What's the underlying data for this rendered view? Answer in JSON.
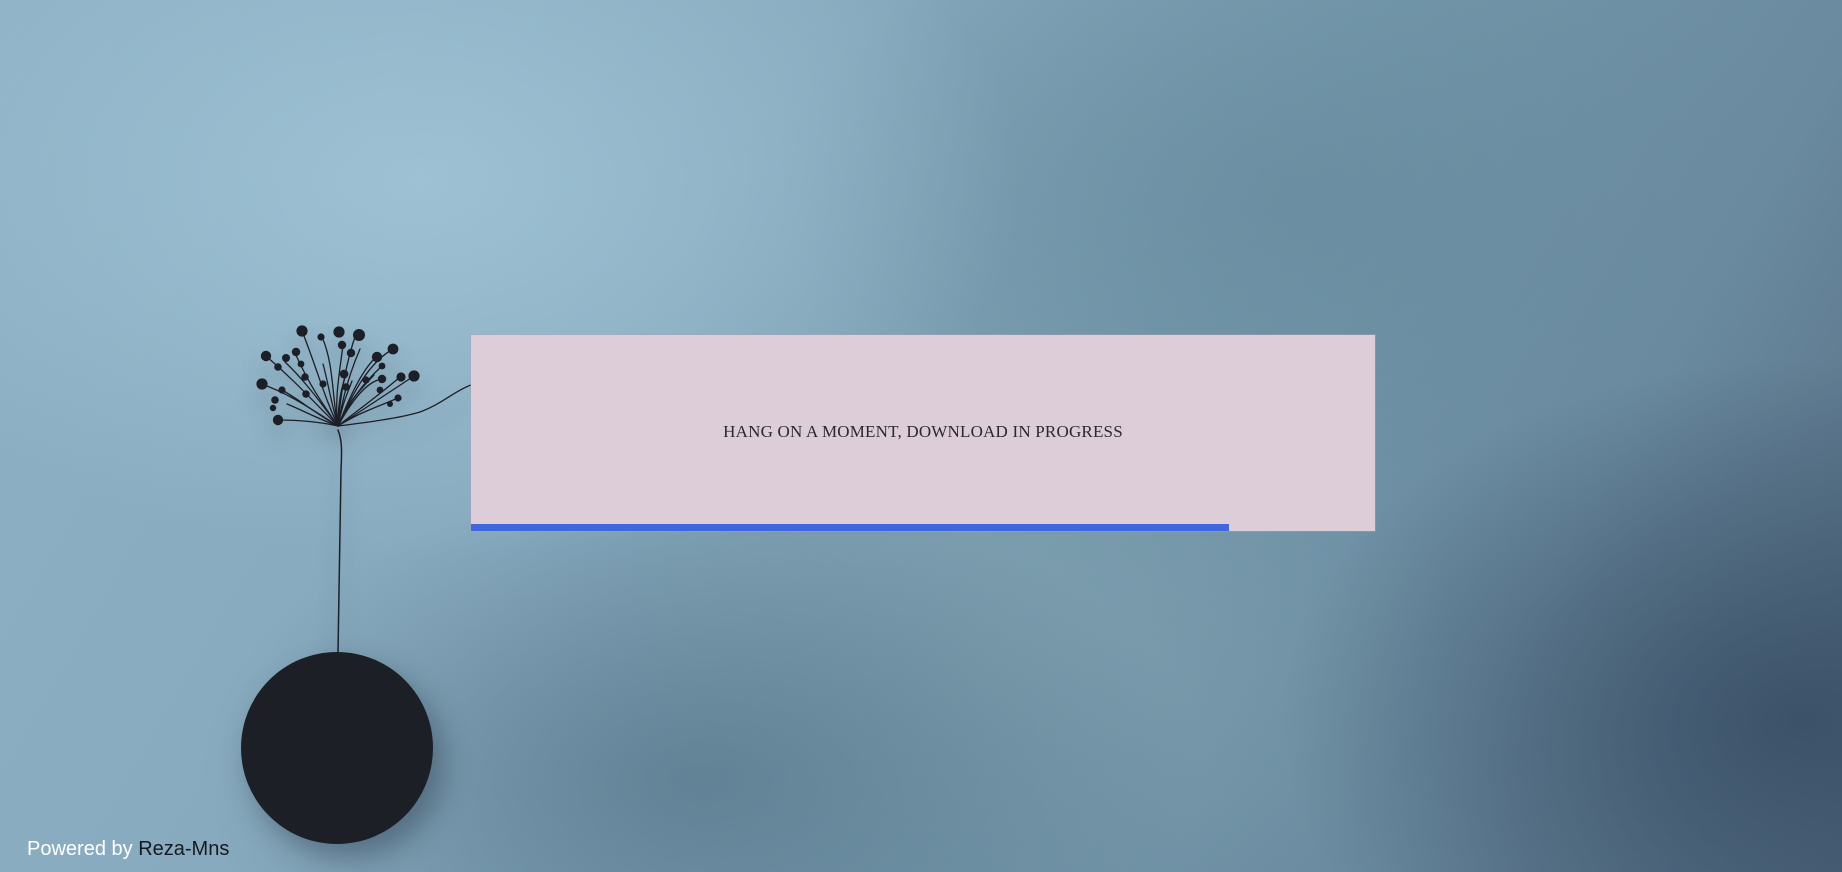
{
  "download": {
    "message": "HANG ON A MOMENT, DOWNLOAD IN PROGRESS",
    "progress_fraction": 0.838,
    "progress_color": "#3f67dd",
    "card_color": "#ddcdd8"
  },
  "footer": {
    "prefix": "Powered by",
    "author": "Reza-Mns"
  },
  "illustration": {
    "subject": "plant-in-round-pot",
    "pot_color": "#1c1f26"
  }
}
